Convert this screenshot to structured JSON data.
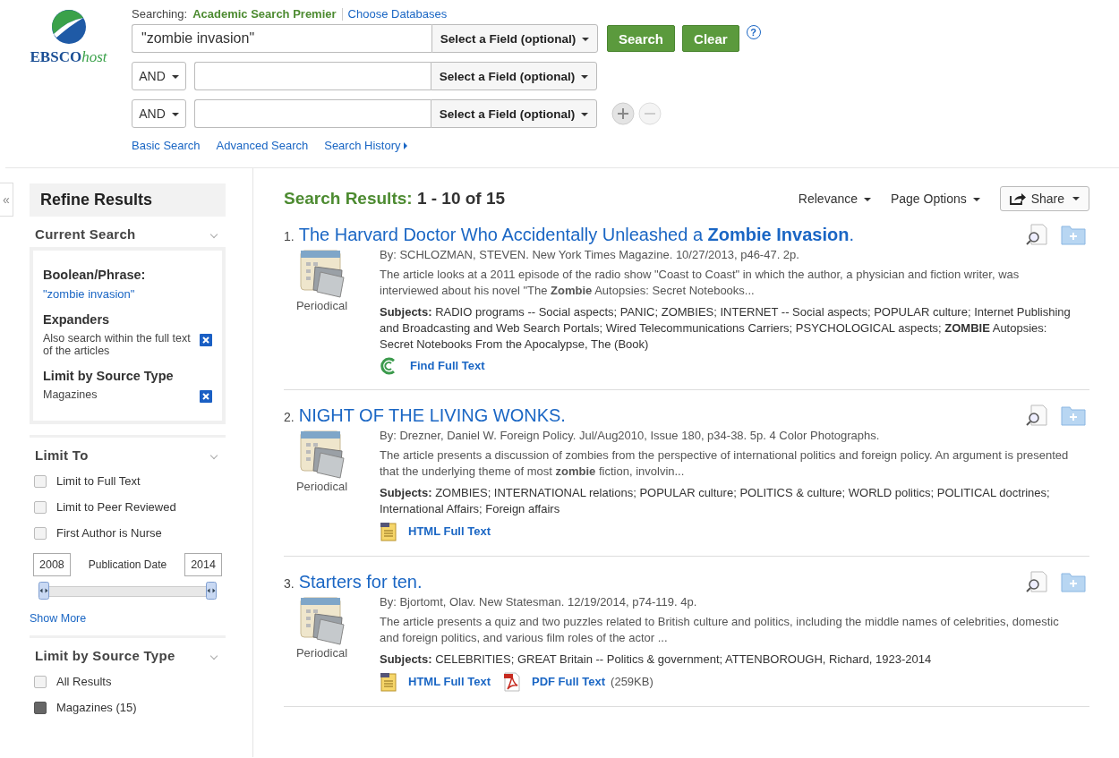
{
  "logo": {
    "main": "EBSCO",
    "suffix": "host"
  },
  "searching": {
    "label": "Searching:",
    "database": "Academic Search Premier",
    "choose_link": "Choose Databases"
  },
  "search_rows": [
    {
      "operator": null,
      "value": "\"zombie invasion\"",
      "field": "Select a Field (optional)"
    },
    {
      "operator": "AND",
      "value": "",
      "field": "Select a Field (optional)"
    },
    {
      "operator": "AND",
      "value": "",
      "field": "Select a Field (optional)"
    }
  ],
  "buttons": {
    "search": "Search",
    "clear": "Clear",
    "help": "?"
  },
  "add_remove": {
    "add_disabled": false,
    "remove_disabled": true
  },
  "search_links": [
    {
      "label": "Basic Search",
      "arrow": false
    },
    {
      "label": "Advanced Search",
      "arrow": false
    },
    {
      "label": "Search History",
      "arrow": true
    }
  ],
  "sidebar": {
    "collapse": "«",
    "title": "Refine Results",
    "current_search": {
      "heading": "Current Search",
      "groups": [
        {
          "label": "Boolean/Phrase:",
          "items": [
            {
              "text": "\"zombie invasion\"",
              "kind": "link"
            }
          ]
        },
        {
          "label": "Expanders",
          "items": [
            {
              "text": "Also search within the full text of the articles",
              "kind": "removable"
            }
          ]
        },
        {
          "label": "Limit by Source Type",
          "items": [
            {
              "text": "Magazines",
              "kind": "removable"
            }
          ]
        }
      ]
    },
    "limit_to": {
      "heading": "Limit To",
      "options": [
        {
          "label": "Limit to Full Text",
          "checked": false
        },
        {
          "label": "Limit to Peer Reviewed",
          "checked": false
        },
        {
          "label": "First Author is Nurse",
          "checked": false
        }
      ],
      "date": {
        "from": "2008",
        "label": "Publication Date",
        "to": "2014"
      },
      "show_more": "Show More"
    },
    "source_type": {
      "heading": "Limit by Source Type",
      "options": [
        {
          "label": "All Results",
          "checked": false
        },
        {
          "label": "Magazines (15)",
          "checked": true
        }
      ]
    }
  },
  "results_header": {
    "label": "Search Results:",
    "range": "1 - 10 of 15",
    "sort": "Relevance",
    "page_options": "Page Options",
    "share": "Share"
  },
  "results": [
    {
      "number": "1.",
      "title": "The Harvard Doctor Who Accidentally Unleashed a **Zombie Invasion**.",
      "type": "Periodical",
      "byline": "By: SCHLOZMAN, STEVEN. New York Times Magazine. 10/27/2013, p46-47. 2p.",
      "abstract": "The article looks at a 2011 episode of the radio show \"Coast to Coast\" in which the author, a physician and fiction writer, was interviewed about his novel \"The **Zombie** Autopsies: Secret Notebooks...",
      "subjects": "**Subjects:** RADIO programs -- Social aspects; PANIC; ZOMBIES; INTERNET -- Social aspects; POPULAR culture; Internet Publishing and Broadcasting and Web Search Portals; Wired Telecommunications Carriers; PSYCHOLOGICAL aspects; **ZOMBIE** Autopsies: Secret Notebooks From the Apocalypse, The (Book)",
      "links": [
        {
          "kind": "find",
          "label": "Find Full Text"
        }
      ]
    },
    {
      "number": "2.",
      "title": "NIGHT OF THE LIVING WONKS.",
      "type": "Periodical",
      "byline": "By: Drezner, Daniel W. Foreign Policy. Jul/Aug2010, Issue 180, p34-38. 5p. 4 Color Photographs.",
      "abstract": "The article presents a discussion of zombies from the perspective of international politics and foreign policy. An argument is presented that the underlying theme of most **zombie** fiction, involvin...",
      "subjects": "**Subjects:** ZOMBIES; INTERNATIONAL relations; POPULAR culture; POLITICS & culture; WORLD politics; POLITICAL doctrines; International Affairs; Foreign affairs",
      "links": [
        {
          "kind": "html",
          "label": "HTML Full Text"
        }
      ]
    },
    {
      "number": "3.",
      "title": "Starters for ten.",
      "type": "Periodical",
      "byline": "By: Bjortomt, Olav. New Statesman. 12/19/2014, p74-119. 4p.",
      "abstract": "The article presents a quiz and two puzzles related to British culture and politics, including the middle names of celebrities, domestic and foreign politics, and various film roles of the actor ...",
      "subjects": "**Subjects:** CELEBRITIES; GREAT Britain -- Politics & government; ATTENBOROUGH, Richard, 1923-2014",
      "links": [
        {
          "kind": "html",
          "label": "HTML Full Text"
        },
        {
          "kind": "pdf",
          "label": "PDF Full Text",
          "size": "(259KB)"
        }
      ]
    }
  ]
}
